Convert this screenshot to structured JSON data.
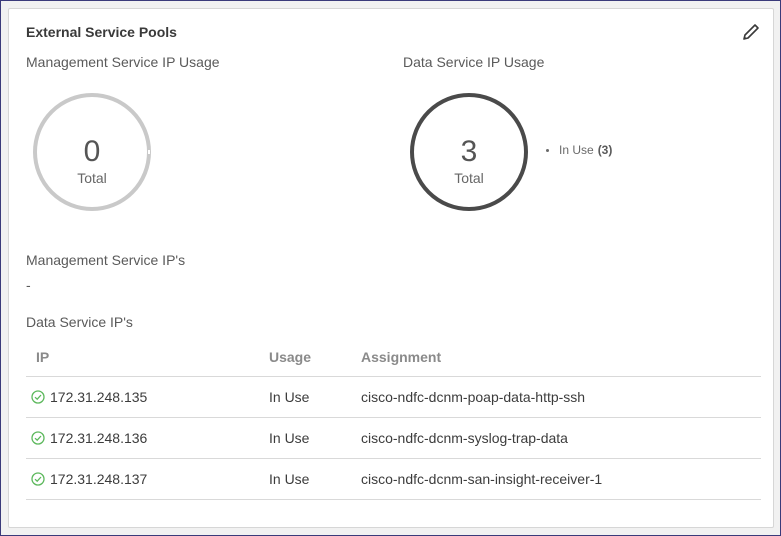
{
  "card": {
    "title": "External Service Pools",
    "edit_icon": "pencil-icon"
  },
  "management_usage": {
    "label": "Management Service IP Usage",
    "total_value": "0",
    "total_label": "Total",
    "ring_color": "#c9c9c9"
  },
  "data_usage": {
    "label": "Data Service IP Usage",
    "total_value": "3",
    "total_label": "Total",
    "ring_color": "#4a4a4a",
    "legend": {
      "label": "In Use",
      "count": "(3)"
    }
  },
  "management_ips": {
    "label": "Management Service IP's",
    "value": "-"
  },
  "data_ips": {
    "label": "Data Service IP's",
    "columns": {
      "ip": "IP",
      "usage": "Usage",
      "assignment": "Assignment"
    },
    "rows": [
      {
        "status_icon": "check-circle-icon",
        "ip": "172.31.248.135",
        "usage": "In Use",
        "assignment": "cisco-ndfc-dcnm-poap-data-http-ssh"
      },
      {
        "status_icon": "check-circle-icon",
        "ip": "172.31.248.136",
        "usage": "In Use",
        "assignment": "cisco-ndfc-dcnm-syslog-trap-data"
      },
      {
        "status_icon": "check-circle-icon",
        "ip": "172.31.248.137",
        "usage": "In Use",
        "assignment": "cisco-ndfc-dcnm-san-insight-receiver-1"
      }
    ]
  },
  "colors": {
    "status_ok": "#5cb85c",
    "border": "#d9d9d9"
  }
}
